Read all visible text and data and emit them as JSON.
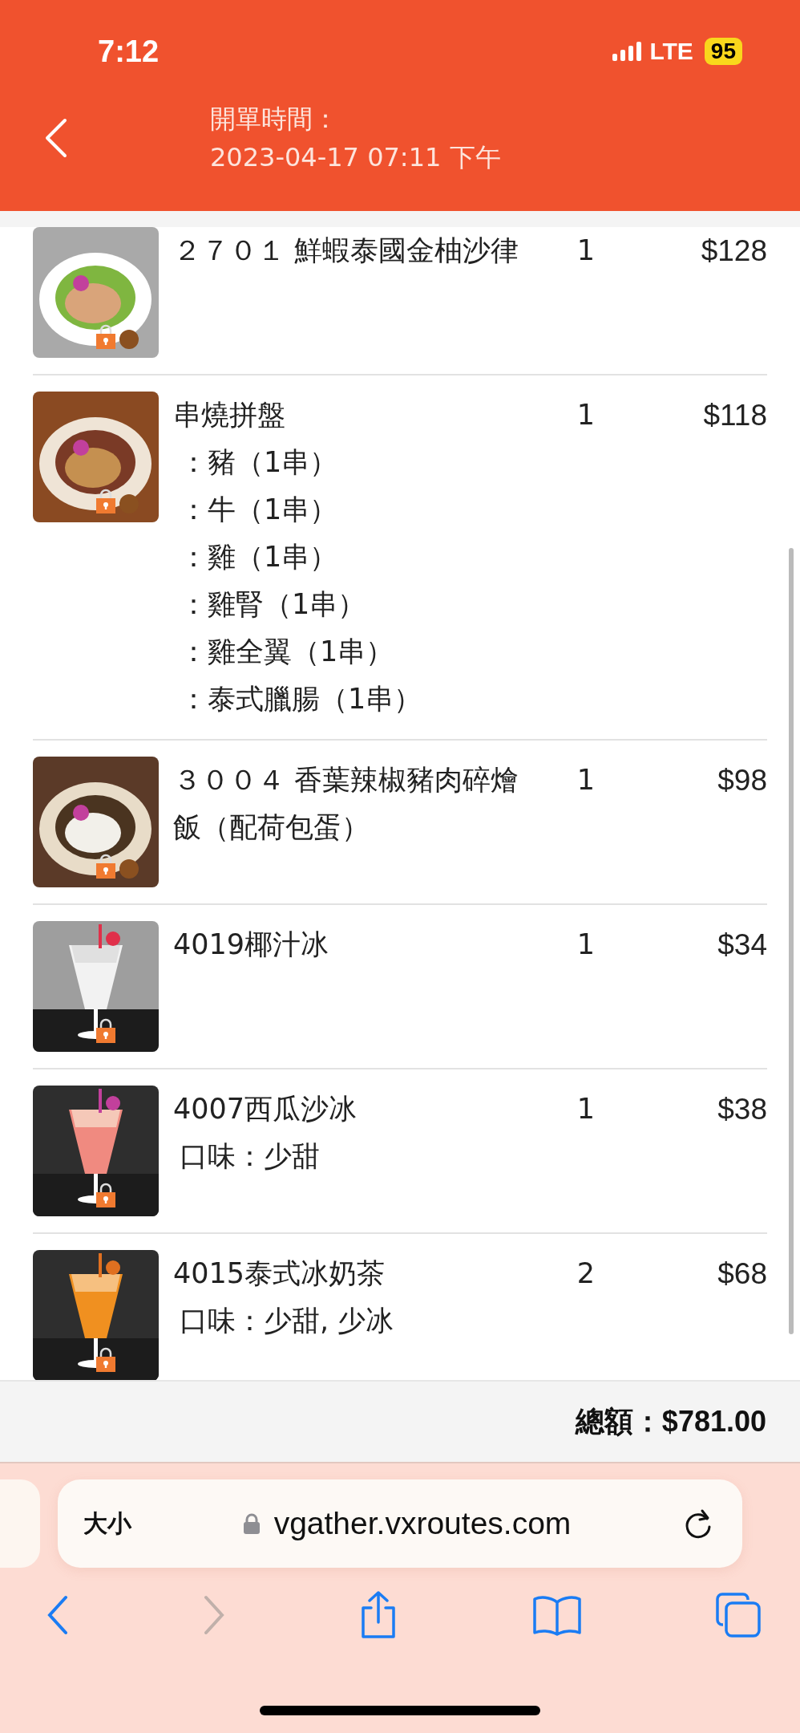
{
  "status_bar": {
    "time": "7:12",
    "network": "LTE",
    "battery": "95"
  },
  "header": {
    "label": "開單時間：",
    "datetime": "2023-04-17 07:11 下午"
  },
  "items": [
    {
      "name": "２７０１ 鮮蝦泰國金柚沙律",
      "qty": "1",
      "price": "$128",
      "picture": {
        "kind": "salad"
      }
    },
    {
      "name": "串燒拼盤",
      "options": [
        "：豬（1串）",
        "：牛（1串）",
        "：雞（1串）",
        "：雞腎（1串）",
        "：雞全翼（1串）",
        "：泰式臘腸（1串）"
      ],
      "qty": "1",
      "price": "$118",
      "picture": {
        "kind": "skewers"
      }
    },
    {
      "name": "３００４ 香葉辣椒豬肉碎燴飯（配荷包蛋）",
      "qty": "1",
      "price": "$98",
      "picture": {
        "kind": "rice"
      }
    },
    {
      "name": "4019椰汁冰",
      "qty": "1",
      "price": "$34",
      "picture": {
        "kind": "drink_white"
      }
    },
    {
      "name": "4007西瓜沙冰",
      "options": [
        "口味：少甜"
      ],
      "qty": "1",
      "price": "$38",
      "picture": {
        "kind": "drink_pink"
      }
    },
    {
      "name": "4015泰式冰奶茶",
      "options": [
        "口味：少甜, 少冰"
      ],
      "qty": "2",
      "price": "$68",
      "picture": {
        "kind": "drink_orange"
      }
    }
  ],
  "total": "總額：$781.00",
  "browser": {
    "text_size": "大小",
    "url": "vgather.vxroutes.com"
  }
}
